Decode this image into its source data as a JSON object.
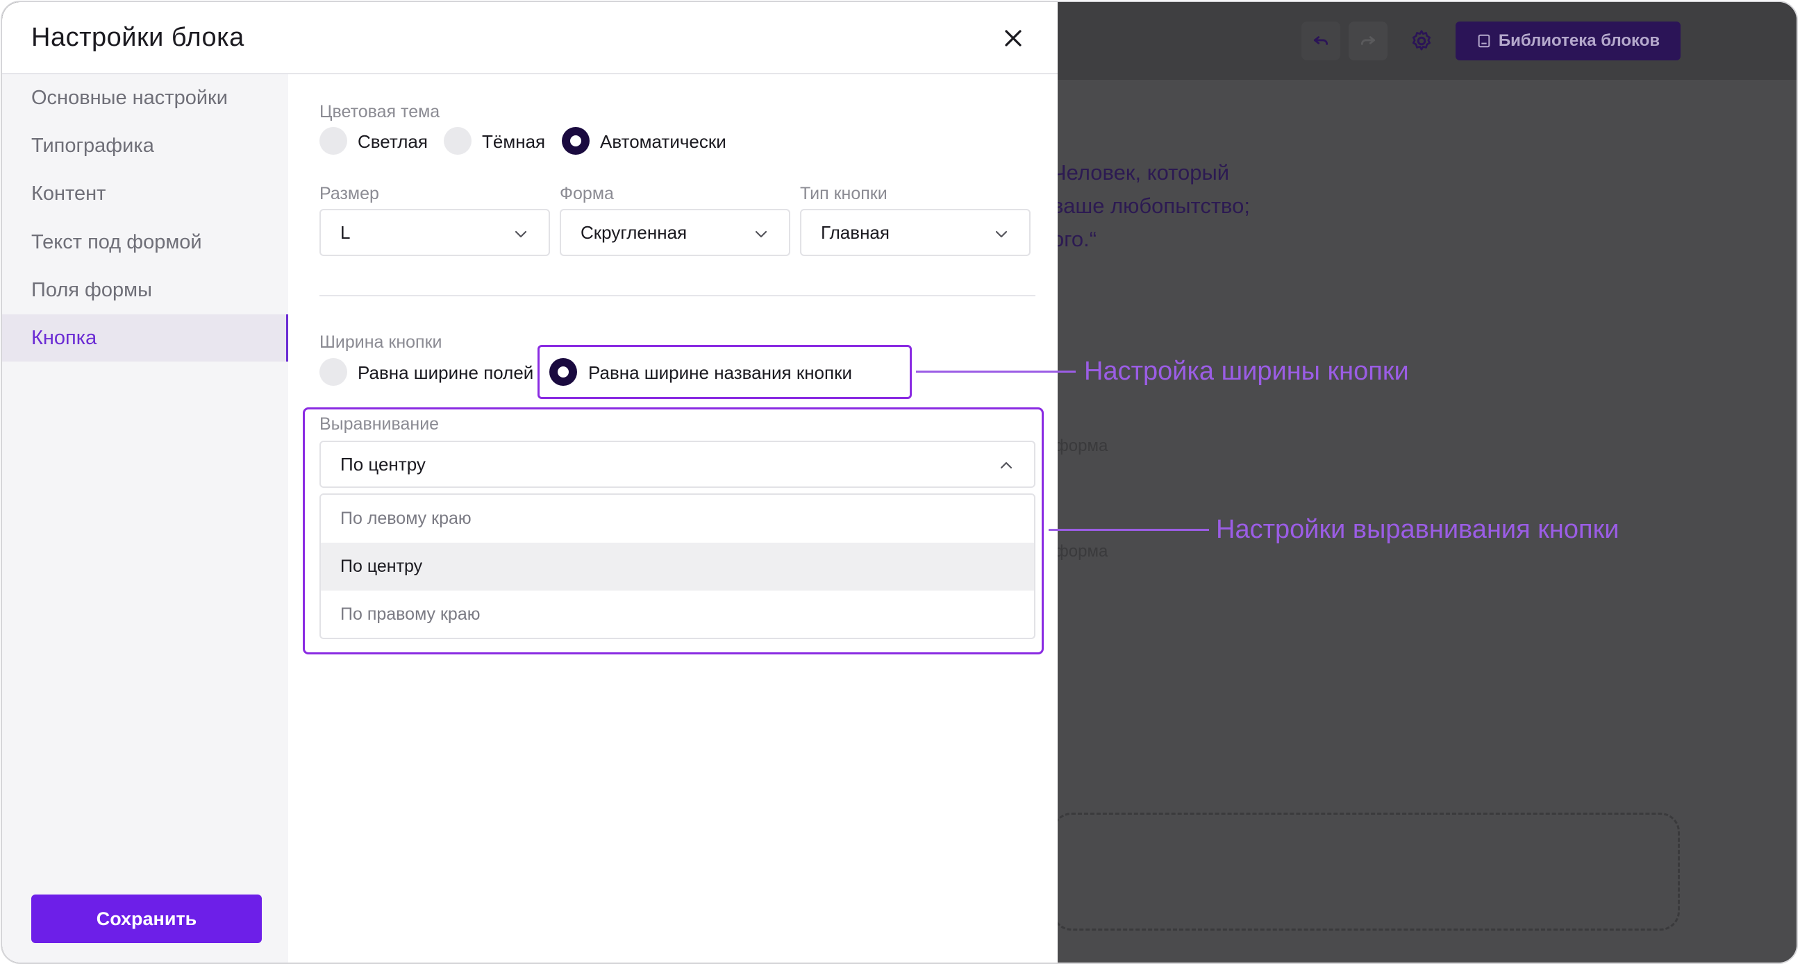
{
  "modal": {
    "title": "Настройки блока",
    "close_icon": "close-icon"
  },
  "sidebar": {
    "items": [
      {
        "label": "Основные настройки",
        "active": false
      },
      {
        "label": "Типографика",
        "active": false
      },
      {
        "label": "Контент",
        "active": false
      },
      {
        "label": "Текст под формой",
        "active": false
      },
      {
        "label": "Поля формы",
        "active": false
      },
      {
        "label": "Кнопка",
        "active": true
      }
    ],
    "save_label": "Сохранить"
  },
  "color_theme": {
    "label": "Цветовая тема",
    "options": [
      "Светлая",
      "Тёмная",
      "Автоматически"
    ],
    "selected": "Автоматически"
  },
  "size": {
    "label": "Размер",
    "value": "L"
  },
  "shape": {
    "label": "Форма",
    "value": "Скругленная"
  },
  "button_type": {
    "label": "Тип кнопки",
    "value": "Главная"
  },
  "button_width": {
    "label": "Ширина кнопки",
    "options": [
      "Равна ширине полей",
      "Равна ширине названия кнопки"
    ],
    "selected": "Равна ширине названия кнопки"
  },
  "alignment": {
    "label": "Выравнивание",
    "value": "По центру",
    "options": [
      "По левому краю",
      "По центру",
      "По правому краю"
    ],
    "selected": "По центру"
  },
  "annotations": {
    "width_callout": "Настройка ширины кнопки",
    "alignment_callout": "Настройки выравнивания кнопки"
  },
  "background": {
    "library_button": "Библиотека блоков",
    "quote": "Человек, который\nваше любопытство;\nого.“",
    "field_label_1": "форма",
    "field_label_2": "форма"
  },
  "colors": {
    "accent": "#6d1fe8",
    "annotation": "#9b5de5",
    "active_nav": "#6b2cd4"
  }
}
